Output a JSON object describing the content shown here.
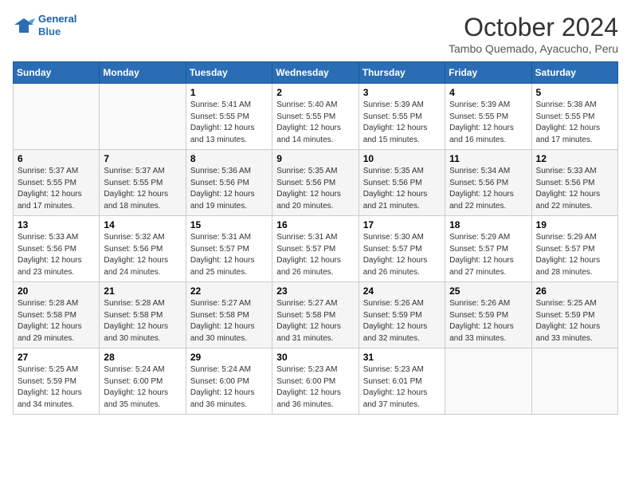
{
  "header": {
    "logo_line1": "General",
    "logo_line2": "Blue",
    "month": "October 2024",
    "location": "Tambo Quemado, Ayacucho, Peru"
  },
  "weekdays": [
    "Sunday",
    "Monday",
    "Tuesday",
    "Wednesday",
    "Thursday",
    "Friday",
    "Saturday"
  ],
  "weeks": [
    [
      {
        "day": "",
        "info": ""
      },
      {
        "day": "",
        "info": ""
      },
      {
        "day": "1",
        "info": "Sunrise: 5:41 AM\nSunset: 5:55 PM\nDaylight: 12 hours\nand 13 minutes."
      },
      {
        "day": "2",
        "info": "Sunrise: 5:40 AM\nSunset: 5:55 PM\nDaylight: 12 hours\nand 14 minutes."
      },
      {
        "day": "3",
        "info": "Sunrise: 5:39 AM\nSunset: 5:55 PM\nDaylight: 12 hours\nand 15 minutes."
      },
      {
        "day": "4",
        "info": "Sunrise: 5:39 AM\nSunset: 5:55 PM\nDaylight: 12 hours\nand 16 minutes."
      },
      {
        "day": "5",
        "info": "Sunrise: 5:38 AM\nSunset: 5:55 PM\nDaylight: 12 hours\nand 17 minutes."
      }
    ],
    [
      {
        "day": "6",
        "info": "Sunrise: 5:37 AM\nSunset: 5:55 PM\nDaylight: 12 hours\nand 17 minutes."
      },
      {
        "day": "7",
        "info": "Sunrise: 5:37 AM\nSunset: 5:55 PM\nDaylight: 12 hours\nand 18 minutes."
      },
      {
        "day": "8",
        "info": "Sunrise: 5:36 AM\nSunset: 5:56 PM\nDaylight: 12 hours\nand 19 minutes."
      },
      {
        "day": "9",
        "info": "Sunrise: 5:35 AM\nSunset: 5:56 PM\nDaylight: 12 hours\nand 20 minutes."
      },
      {
        "day": "10",
        "info": "Sunrise: 5:35 AM\nSunset: 5:56 PM\nDaylight: 12 hours\nand 21 minutes."
      },
      {
        "day": "11",
        "info": "Sunrise: 5:34 AM\nSunset: 5:56 PM\nDaylight: 12 hours\nand 22 minutes."
      },
      {
        "day": "12",
        "info": "Sunrise: 5:33 AM\nSunset: 5:56 PM\nDaylight: 12 hours\nand 22 minutes."
      }
    ],
    [
      {
        "day": "13",
        "info": "Sunrise: 5:33 AM\nSunset: 5:56 PM\nDaylight: 12 hours\nand 23 minutes."
      },
      {
        "day": "14",
        "info": "Sunrise: 5:32 AM\nSunset: 5:56 PM\nDaylight: 12 hours\nand 24 minutes."
      },
      {
        "day": "15",
        "info": "Sunrise: 5:31 AM\nSunset: 5:57 PM\nDaylight: 12 hours\nand 25 minutes."
      },
      {
        "day": "16",
        "info": "Sunrise: 5:31 AM\nSunset: 5:57 PM\nDaylight: 12 hours\nand 26 minutes."
      },
      {
        "day": "17",
        "info": "Sunrise: 5:30 AM\nSunset: 5:57 PM\nDaylight: 12 hours\nand 26 minutes."
      },
      {
        "day": "18",
        "info": "Sunrise: 5:29 AM\nSunset: 5:57 PM\nDaylight: 12 hours\nand 27 minutes."
      },
      {
        "day": "19",
        "info": "Sunrise: 5:29 AM\nSunset: 5:57 PM\nDaylight: 12 hours\nand 28 minutes."
      }
    ],
    [
      {
        "day": "20",
        "info": "Sunrise: 5:28 AM\nSunset: 5:58 PM\nDaylight: 12 hours\nand 29 minutes."
      },
      {
        "day": "21",
        "info": "Sunrise: 5:28 AM\nSunset: 5:58 PM\nDaylight: 12 hours\nand 30 minutes."
      },
      {
        "day": "22",
        "info": "Sunrise: 5:27 AM\nSunset: 5:58 PM\nDaylight: 12 hours\nand 30 minutes."
      },
      {
        "day": "23",
        "info": "Sunrise: 5:27 AM\nSunset: 5:58 PM\nDaylight: 12 hours\nand 31 minutes."
      },
      {
        "day": "24",
        "info": "Sunrise: 5:26 AM\nSunset: 5:59 PM\nDaylight: 12 hours\nand 32 minutes."
      },
      {
        "day": "25",
        "info": "Sunrise: 5:26 AM\nSunset: 5:59 PM\nDaylight: 12 hours\nand 33 minutes."
      },
      {
        "day": "26",
        "info": "Sunrise: 5:25 AM\nSunset: 5:59 PM\nDaylight: 12 hours\nand 33 minutes."
      }
    ],
    [
      {
        "day": "27",
        "info": "Sunrise: 5:25 AM\nSunset: 5:59 PM\nDaylight: 12 hours\nand 34 minutes."
      },
      {
        "day": "28",
        "info": "Sunrise: 5:24 AM\nSunset: 6:00 PM\nDaylight: 12 hours\nand 35 minutes."
      },
      {
        "day": "29",
        "info": "Sunrise: 5:24 AM\nSunset: 6:00 PM\nDaylight: 12 hours\nand 36 minutes."
      },
      {
        "day": "30",
        "info": "Sunrise: 5:23 AM\nSunset: 6:00 PM\nDaylight: 12 hours\nand 36 minutes."
      },
      {
        "day": "31",
        "info": "Sunrise: 5:23 AM\nSunset: 6:01 PM\nDaylight: 12 hours\nand 37 minutes."
      },
      {
        "day": "",
        "info": ""
      },
      {
        "day": "",
        "info": ""
      }
    ]
  ]
}
